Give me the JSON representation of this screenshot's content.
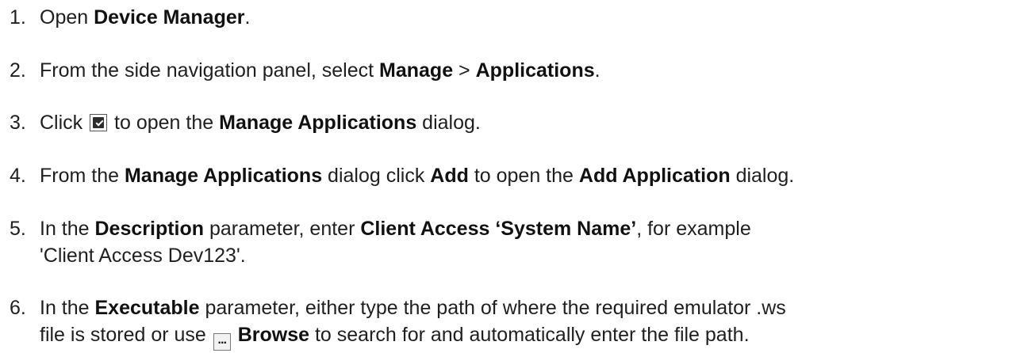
{
  "steps": [
    {
      "num": "1.",
      "t1": "Open ",
      "b1": "Device Manager",
      "t2": "."
    },
    {
      "num": "2.",
      "t1": "From the side navigation panel, select ",
      "b1": "Manage",
      "t2": " > ",
      "b2": "Applications",
      "t3": "."
    },
    {
      "num": "3.",
      "t1": "Click ",
      "icon": "manage-applications-icon",
      "t2": " to open the ",
      "b1": "Manage Applications",
      "t3": " dialog."
    },
    {
      "num": "4.",
      "t1": "From the ",
      "b1": "Manage Applications",
      "t2": " dialog click ",
      "b2": "Add",
      "t3": " to open the ",
      "b3": "Add Application",
      "t4": " dialog."
    },
    {
      "num": "5.",
      "t1": "In the ",
      "b1": "Description",
      "t2": " parameter, enter ",
      "b2": "Client Access ‘System Name’",
      "t3": ", for example",
      "line2": "'Client Access Dev123'."
    },
    {
      "num": "6.",
      "t1": "In the ",
      "b1": "Executable",
      "t2": " parameter, either type the path of where the required emulator .ws",
      "line2a": "file is stored or use ",
      "icon": "browse-icon",
      "icon_text": "...",
      "b2": "Browse",
      "line2b": " to search for and automatically enter the file path."
    }
  ]
}
